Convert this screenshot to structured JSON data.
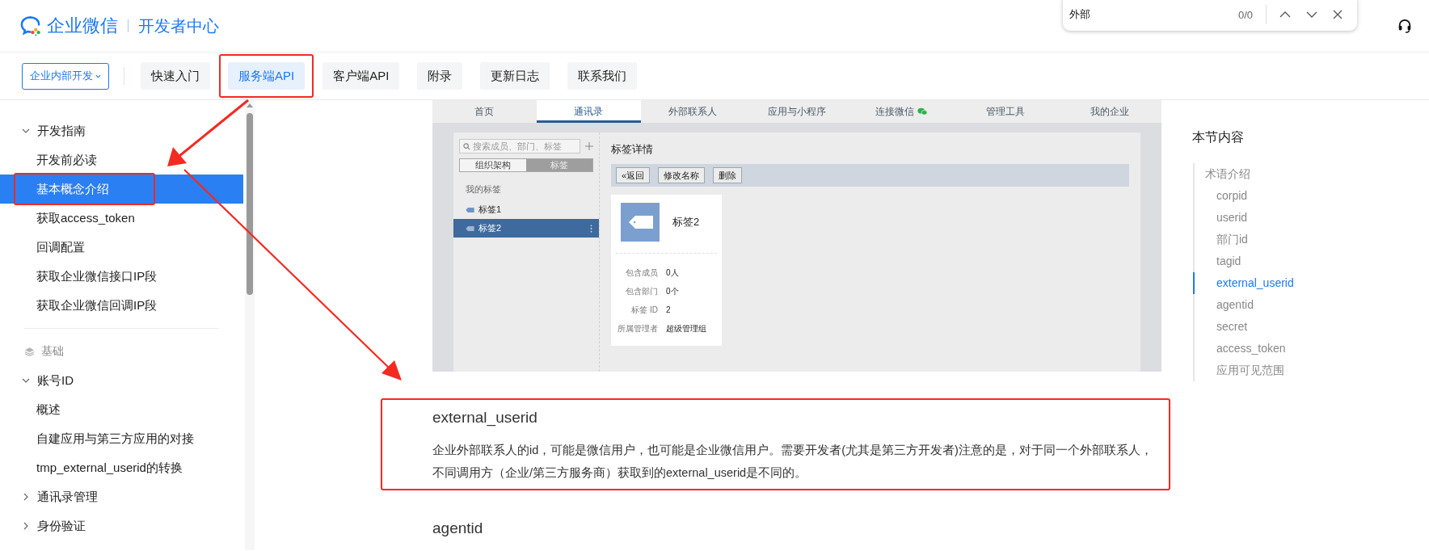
{
  "header": {
    "logo": "企业微信",
    "subtitle": "开发者中心"
  },
  "find_bar": {
    "value": "外部",
    "count": "0/0"
  },
  "nav": {
    "dropdown": "企业内部开发",
    "items": [
      {
        "label": "快速入门",
        "selected": false,
        "highlighted": false
      },
      {
        "label": "服务端API",
        "selected": true,
        "highlighted": true
      },
      {
        "label": "客户端API",
        "selected": false,
        "highlighted": false
      },
      {
        "label": "附录",
        "selected": false,
        "highlighted": false
      },
      {
        "label": "更新日志",
        "selected": false,
        "highlighted": false
      },
      {
        "label": "联系我们",
        "selected": false,
        "highlighted": false
      }
    ]
  },
  "sidebar": {
    "groups": [
      {
        "kind": "section",
        "label": "开发指南",
        "expanded": true,
        "children": [
          {
            "label": "开发前必读",
            "selected": false,
            "highlighted": false
          },
          {
            "label": "基本概念介绍",
            "selected": true,
            "highlighted": true
          },
          {
            "label": "获取access_token",
            "selected": false,
            "highlighted": false
          },
          {
            "label": "回调配置",
            "selected": false,
            "highlighted": false
          },
          {
            "label": "获取企业微信接口IP段",
            "selected": false,
            "highlighted": false
          },
          {
            "label": "获取企业微信回调IP段",
            "selected": false,
            "highlighted": false
          }
        ]
      },
      {
        "kind": "category",
        "label": "基础"
      },
      {
        "kind": "section",
        "label": "账号ID",
        "expanded": true,
        "children": [
          {
            "label": "概述",
            "selected": false,
            "highlighted": false
          },
          {
            "label": "自建应用与第三方应用的对接",
            "selected": false,
            "highlighted": false
          },
          {
            "label": "tmp_external_userid的转换",
            "selected": false,
            "highlighted": false
          }
        ]
      },
      {
        "kind": "section",
        "label": "通讯录管理",
        "expanded": false
      },
      {
        "kind": "section",
        "label": "身份验证",
        "expanded": false
      }
    ]
  },
  "screenshot": {
    "tabs": [
      {
        "label": "首页",
        "selected": false,
        "has_icon": false
      },
      {
        "label": "通讯录",
        "selected": true,
        "has_icon": false
      },
      {
        "label": "外部联系人",
        "selected": false,
        "has_icon": false
      },
      {
        "label": "应用与小程序",
        "selected": false,
        "has_icon": false
      },
      {
        "label": "连接微信",
        "selected": false,
        "has_icon": true
      },
      {
        "label": "管理工具",
        "selected": false,
        "has_icon": false
      },
      {
        "label": "我的企业",
        "selected": false,
        "has_icon": false
      }
    ],
    "search_placeholder": "搜索成员、部门、标签",
    "view_tabs": [
      {
        "label": "组织架构",
        "selected": false
      },
      {
        "label": "标签",
        "selected": true
      }
    ],
    "tag_list_title": "我的标签",
    "tags": [
      {
        "label": "标签1",
        "selected": false
      },
      {
        "label": "标签2",
        "selected": true
      }
    ],
    "detail_title": "标签详情",
    "buttons": [
      "«返回",
      "修改名称",
      "删除"
    ],
    "card": {
      "name": "标签2",
      "fields": [
        {
          "label": "包含成员",
          "value": "0人"
        },
        {
          "label": "包含部门",
          "value": "0个"
        },
        {
          "label": "标签 ID",
          "value": "2"
        },
        {
          "label": "所属管理者",
          "value": "超级管理组"
        }
      ]
    }
  },
  "sections": [
    {
      "heading": "external_userid",
      "body": "企业外部联系人的id，可能是微信用户，也可能是企业微信用户。需要开发者(尤其是第三方开发者)注意的是，对于同一个外部联系人，不同调用方（企业/第三方服务商）获取到的external_userid是不同的。",
      "highlighted": true
    },
    {
      "heading": "agentid",
      "highlighted": false
    }
  ],
  "toc": {
    "title": "本节内容",
    "items": [
      {
        "label": "术语介绍",
        "selected": false,
        "children": [
          {
            "label": "corpid",
            "selected": false
          },
          {
            "label": "userid",
            "selected": false
          },
          {
            "label": "部门id",
            "selected": false
          },
          {
            "label": "tagid",
            "selected": false
          },
          {
            "label": "external_userid",
            "selected": true
          },
          {
            "label": "agentid",
            "selected": false
          },
          {
            "label": "secret",
            "selected": false
          },
          {
            "label": "access_token",
            "selected": false
          },
          {
            "label": "应用可见范围",
            "selected": false
          }
        ]
      }
    ]
  }
}
